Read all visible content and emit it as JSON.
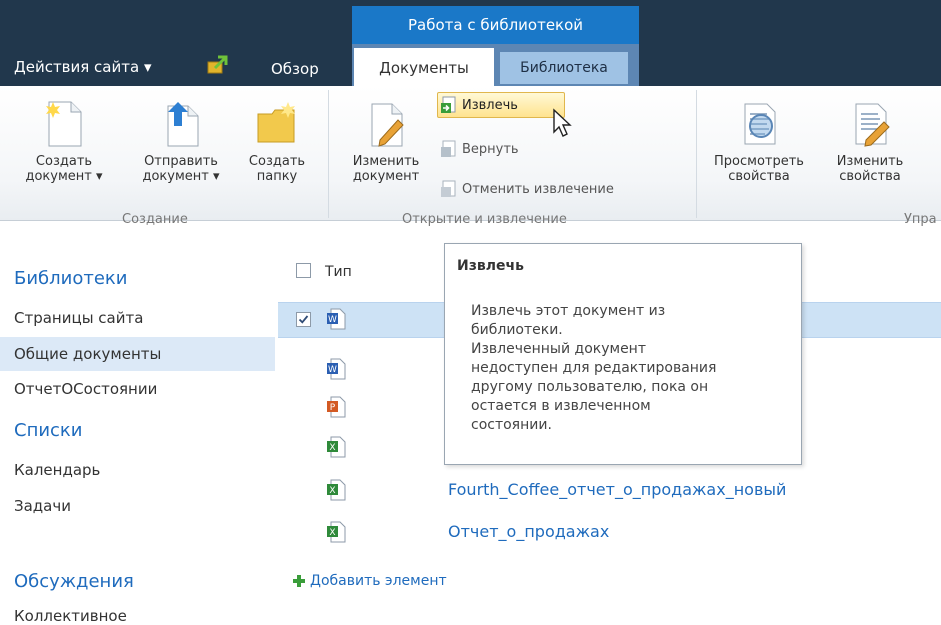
{
  "top": {
    "contextual_group": "Работа с библиотекой",
    "site_actions": "Действия сайта ▾",
    "tabs": [
      "Обзор",
      "Документы",
      "Библиотека"
    ]
  },
  "ribbon": {
    "create_doc": [
      "Создать",
      "документ ▾"
    ],
    "upload_doc": [
      "Отправить",
      "документ ▾"
    ],
    "new_folder": [
      "Создать",
      "папку"
    ],
    "edit_doc": [
      "Изменить",
      "документ"
    ],
    "check_out": "Извлечь",
    "check_in": "Вернуть",
    "discard": "Отменить извлечение",
    "view_props": [
      "Просмотреть",
      "свойства"
    ],
    "edit_props": [
      "Изменить",
      "свойства"
    ],
    "groups": [
      "Создание",
      "Открытие и извлечение",
      "Упра"
    ]
  },
  "nav": {
    "libraries": "Библиотеки",
    "items1": [
      "Страницы сайта",
      "Общие документы",
      "ОтчетОСостоянии"
    ],
    "lists": "Списки",
    "items2": [
      "Календарь",
      "Задачи"
    ],
    "discussions": "Обсуждения",
    "items3": [
      "Коллективное"
    ]
  },
  "list": {
    "type_header": "Тип",
    "docs": [
      "Fourth_Coffee_отчет_о_продажах_новый",
      "Отчет_о_продажах"
    ],
    "add_item": "Добавить элемент"
  },
  "tooltip": {
    "title": "Извлечь",
    "body": "Извлечь этот документ из\nбиблиотеки.\nИзвлеченный документ\nнедоступен для редактирования\nдругому пользователю, пока он\nостается в извлеченном\nсостоянии."
  },
  "colors": {
    "topbar": "#21374c",
    "context_tab": "#1a78c8",
    "link": "#1f6bbd",
    "selected_row": "#cde2f5"
  }
}
